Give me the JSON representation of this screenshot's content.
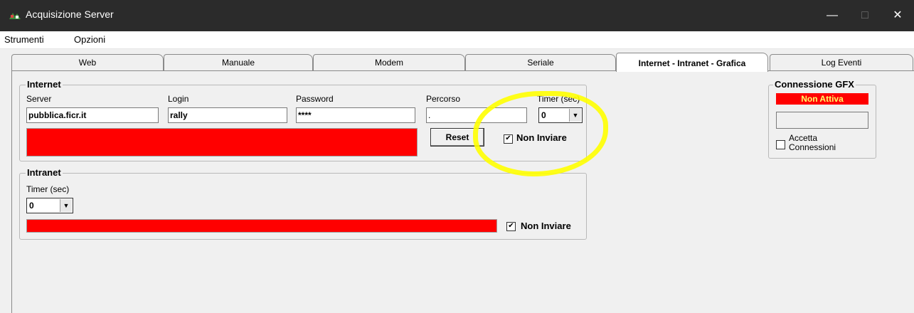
{
  "window": {
    "title": "Acquisizione Server",
    "minimize": "—",
    "maximize": "□",
    "close": "✕"
  },
  "menu": {
    "items": [
      "Strumenti",
      "Opzioni"
    ]
  },
  "tabs": [
    "Web",
    "Manuale",
    "Modem",
    "Seriale",
    "Internet - Intranet - Grafica",
    "Log Eventi"
  ],
  "active_tab": "Internet - Intranet - Grafica",
  "internet": {
    "title": "Internet",
    "server_label": "Server",
    "server_value": "pubblica.ficr.it",
    "login_label": "Login",
    "login_value": "rally",
    "password_label": "Password",
    "password_value": "****",
    "percorso_label": "Percorso",
    "percorso_value": ".",
    "timer_label": "Timer (sec)",
    "timer_value": "0",
    "reset_label": "Reset",
    "non_inviare_label": "Non Inviare",
    "non_inviare_checked": true
  },
  "intranet": {
    "title": "Intranet",
    "timer_label": "Timer (sec)",
    "timer_value": "0",
    "non_inviare_label": "Non Inviare",
    "non_inviare_checked": true
  },
  "gfx": {
    "title": "Connessione GFX",
    "status": "Non Attiva",
    "field_value": "",
    "accetta_label_1": "Accetta",
    "accetta_label_2": "Connessioni",
    "accetta_checked": false
  },
  "colors": {
    "status_red": "#ff0000",
    "highlight": "#ffff00",
    "titlebar": "#2b2b2b"
  }
}
